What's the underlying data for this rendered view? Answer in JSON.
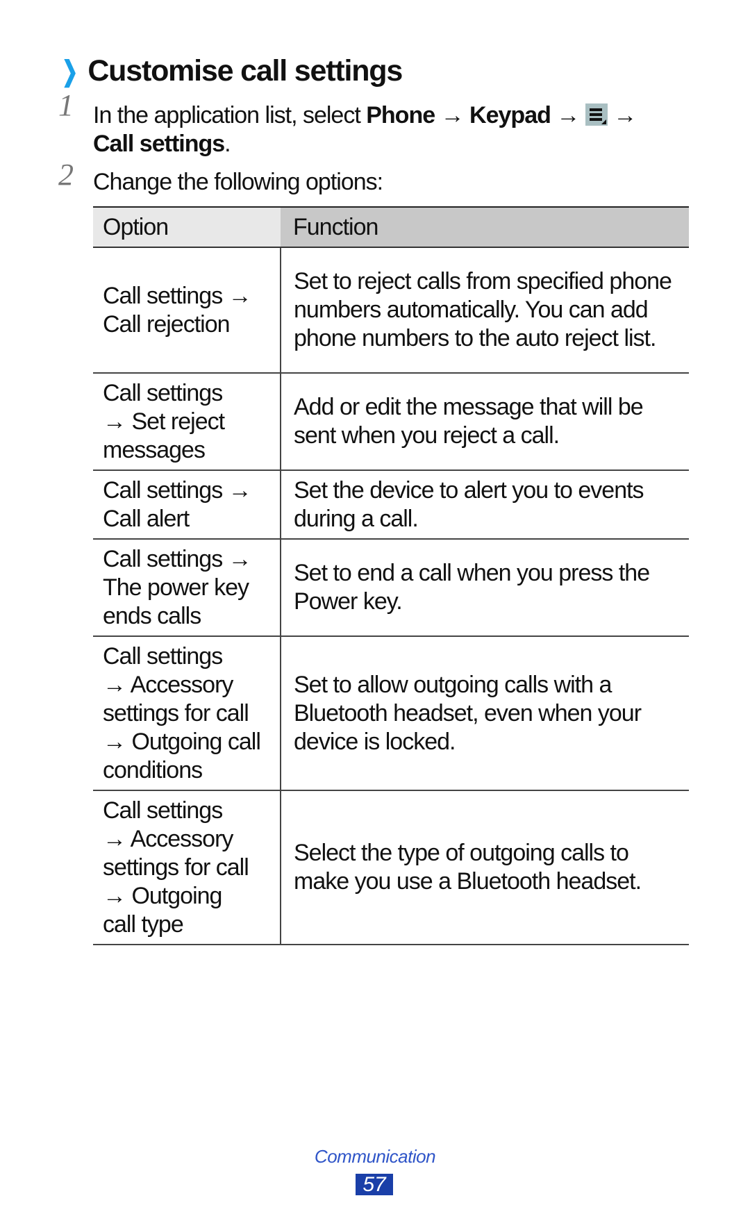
{
  "heading": {
    "icon": "chevron-right-icon",
    "title": "Customise call settings",
    "accent_color": "#1aa0e8"
  },
  "steps": [
    {
      "number": "1",
      "parts": {
        "prefix": "In the application list, select ",
        "phone": "Phone",
        "arrow1": " → ",
        "keypad": "Keypad",
        "arrow2": " → ",
        "icon": "menu-icon",
        "arrow3": " →",
        "call_settings": "Call settings",
        "suffix": "."
      }
    },
    {
      "number": "2",
      "text": "Change the following options:"
    }
  ],
  "table": {
    "headers": [
      "Option",
      "Function"
    ],
    "rows": [
      {
        "option": [
          "Call settings →",
          "Call rejection"
        ],
        "function": "Set to reject calls from specified phone numbers automatically. You can add phone numbers to the auto reject list."
      },
      {
        "option": [
          "Call settings",
          "→ Set reject",
          "messages"
        ],
        "function": "Add or edit the message that will be sent when you reject a call."
      },
      {
        "option": [
          "Call settings →",
          "Call alert"
        ],
        "function": "Set the device to alert you to events during a call."
      },
      {
        "option": [
          "Call settings →",
          "The power key",
          "ends calls"
        ],
        "function": "Set to end a call when you press the Power key."
      },
      {
        "option": [
          "Call settings",
          "→ Accessory",
          "settings for call",
          "→ Outgoing call",
          "conditions"
        ],
        "function": "Set to allow outgoing calls with a Bluetooth headset, even when your device is locked."
      },
      {
        "option": [
          "Call settings",
          "→ Accessory",
          "settings for call",
          "→ Outgoing",
          "call type"
        ],
        "function": "Select the type of outgoing calls to make you use a Bluetooth headset."
      }
    ]
  },
  "footer": {
    "section": "Communication",
    "page": "57",
    "section_color": "#2f55c8",
    "page_bg_color": "#1a3fa8"
  }
}
